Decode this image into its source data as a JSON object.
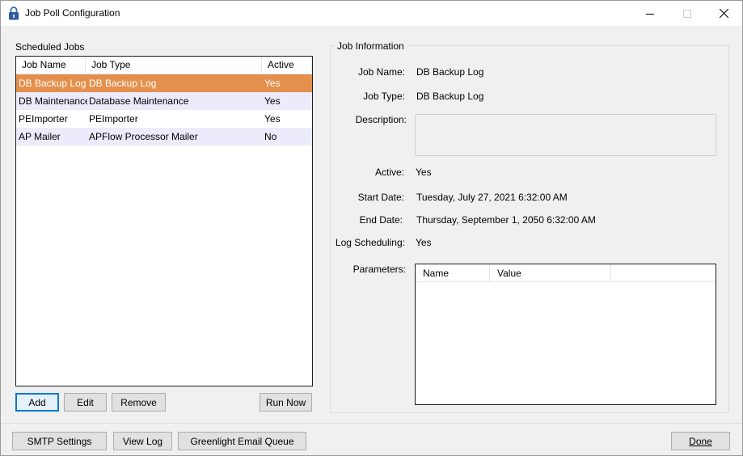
{
  "window": {
    "title": "Job Poll Configuration",
    "icon": "lock-icon"
  },
  "scheduled_jobs": {
    "label": "Scheduled Jobs",
    "columns": [
      "Job Name",
      "Job Type",
      "Active"
    ],
    "rows": [
      {
        "name": "DB Backup Log",
        "type": "DB Backup Log",
        "active": "Yes",
        "selected": true
      },
      {
        "name": "DB Maintenance",
        "type": "Database Maintenance",
        "active": "Yes",
        "selected": false
      },
      {
        "name": "PEImporter",
        "type": "PEImporter",
        "active": "Yes",
        "selected": false
      },
      {
        "name": "AP Mailer",
        "type": "APFlow Processor Mailer",
        "active": "No",
        "selected": false
      }
    ],
    "buttons": {
      "add": "Add",
      "edit": "Edit",
      "remove": "Remove",
      "run_now": "Run Now"
    }
  },
  "job_info": {
    "title": "Job Information",
    "labels": {
      "job_name": "Job Name:",
      "job_type": "Job Type:",
      "description": "Description:",
      "active": "Active:",
      "start_date": "Start Date:",
      "end_date": "End Date:",
      "log_scheduling": "Log Scheduling:",
      "parameters": "Parameters:"
    },
    "values": {
      "job_name": "DB Backup Log",
      "job_type": "DB Backup Log",
      "description": "",
      "active": "Yes",
      "start_date": "Tuesday, July 27, 2021 6:32:00 AM",
      "end_date": "Thursday, September 1, 2050 6:32:00 AM",
      "log_scheduling": "Yes"
    },
    "parameters_columns": [
      "Name",
      "Value"
    ]
  },
  "footer": {
    "smtp": "SMTP Settings",
    "view_log": "View Log",
    "greenlight": "Greenlight Email Queue",
    "done": "Done"
  },
  "colors": {
    "selection": "#e4904c",
    "alt_row": "#ebebfb",
    "accent": "#0078d7"
  }
}
